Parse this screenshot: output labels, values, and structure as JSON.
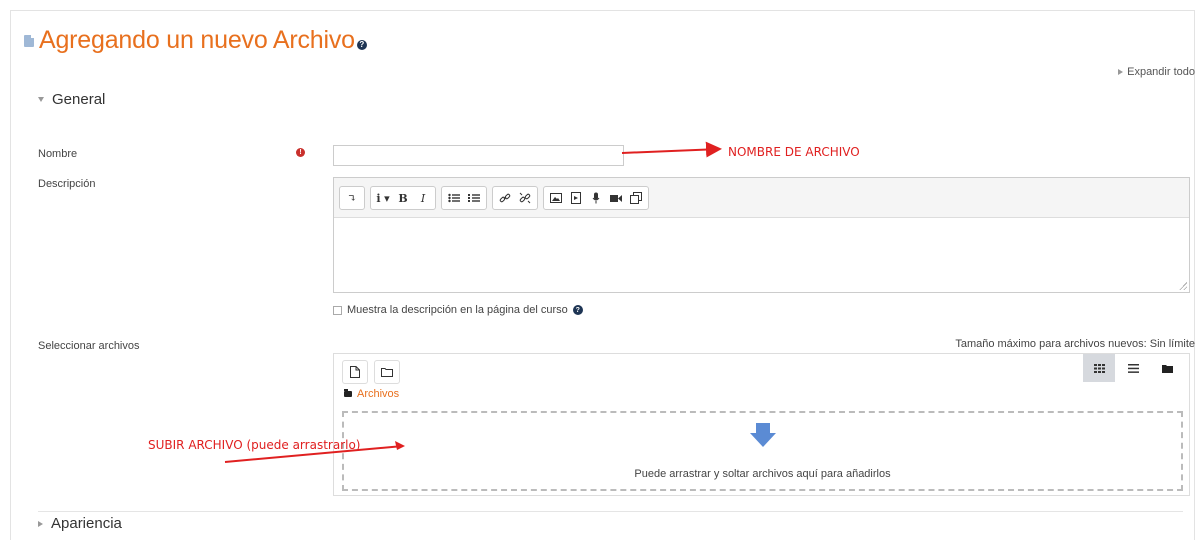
{
  "page": {
    "title": "Agregando un nuevo Archivo",
    "expand_all": "Expandir todo"
  },
  "sections": {
    "general": "General",
    "appearance": "Apariencia"
  },
  "form": {
    "name_label": "Nombre",
    "name_value": "",
    "description_label": "Descripción",
    "show_description_label": "Muestra la descripción en la página del curso",
    "select_files_label": "Seleccionar archivos",
    "max_size_text": "Tamaño máximo para archivos nuevos: Sin límite"
  },
  "editor": {
    "toolbar": [
      "undo-redo",
      "info",
      "bold",
      "italic",
      "bullet-list",
      "numbered-list",
      "link",
      "unlink",
      "image",
      "media",
      "record-audio",
      "record-video",
      "manage-files"
    ]
  },
  "filepicker": {
    "path_label": "Archivos",
    "drop_text": "Puede arrastrar y soltar archivos aquí para añadirlos"
  },
  "annotations": {
    "name_note": "NOMBRE DE ARCHIVO",
    "upload_note": "SUBIR ARCHIVO (puede arrastrarlo)",
    "color": "#e02020"
  },
  "colors": {
    "accent": "#e8701e",
    "required": "#c9302c",
    "help": "#1e3554"
  }
}
